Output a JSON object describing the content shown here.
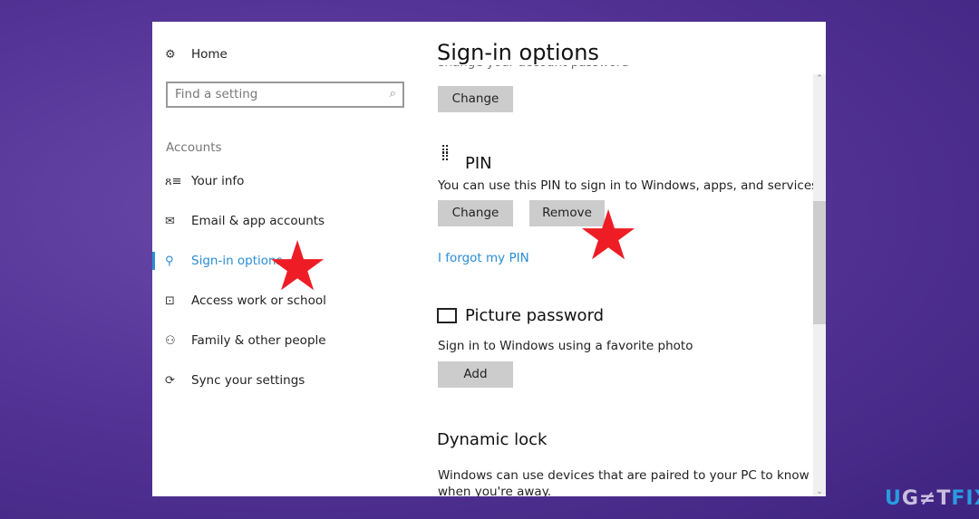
{
  "sidebar": {
    "home": "Home",
    "search_placeholder": "Find a setting",
    "section": "Accounts",
    "items": [
      {
        "label": "Your info",
        "icon": "person-card-icon"
      },
      {
        "label": "Email & app accounts",
        "icon": "mail-icon"
      },
      {
        "label": "Sign-in options",
        "icon": "key-icon",
        "active": true
      },
      {
        "label": "Access work or school",
        "icon": "briefcase-icon"
      },
      {
        "label": "Family & other people",
        "icon": "person-add-icon"
      },
      {
        "label": "Sync your settings",
        "icon": "sync-icon"
      }
    ]
  },
  "main": {
    "title": "Sign-in options",
    "password_desc": "Change your account password",
    "password_change": "Change",
    "pin": {
      "title": "PIN",
      "desc": "You can use this PIN to sign in to Windows, apps, and services.",
      "change": "Change",
      "remove": "Remove",
      "forgot": "I forgot my PIN"
    },
    "picture": {
      "title": "Picture password",
      "desc": "Sign in to Windows using a favorite photo",
      "add": "Add"
    },
    "dynamic": {
      "title": "Dynamic lock",
      "desc": "Windows can use devices that are paired to your PC to know when you're away."
    }
  },
  "watermark": {
    "u": "U",
    "get": "G≠T",
    "fix": "FIX"
  },
  "colors": {
    "accent": "#2a8dd4",
    "marker": "#ee1c25"
  }
}
